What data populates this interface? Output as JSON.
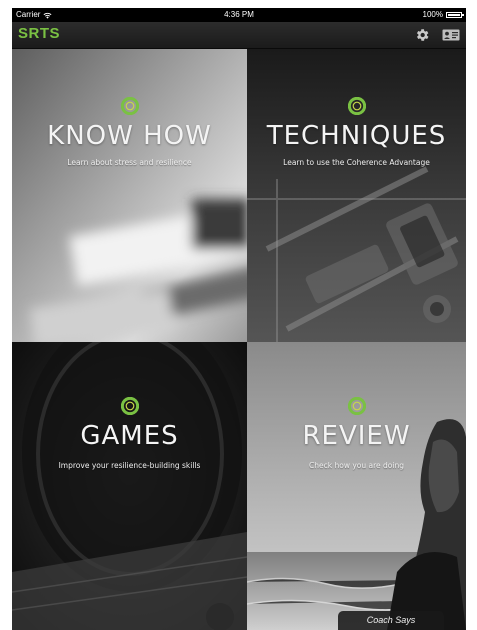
{
  "status_bar": {
    "carrier": "Carrier",
    "time": "4:36 PM",
    "battery": "100%"
  },
  "nav": {
    "brand": "SRTS",
    "brand_color": "#7ac143",
    "icons": [
      "gear-icon",
      "profile-card-icon"
    ]
  },
  "tiles": [
    {
      "title": "KNOW HOW",
      "subtitle": "Learn about stress and resilience"
    },
    {
      "title": "TECHNIQUES",
      "subtitle": "Learn to use the Coherence Advantage"
    },
    {
      "title": "GAMES",
      "subtitle": "Improve your resilience-building skills"
    },
    {
      "title": "REVIEW",
      "subtitle": "Check how you are doing"
    }
  ],
  "coach_tab": {
    "label": "Coach Says"
  }
}
